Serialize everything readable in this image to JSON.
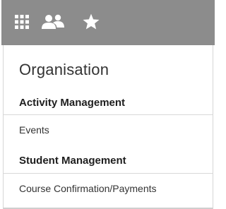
{
  "toolbar": {
    "icons": [
      "apps-grid-icon",
      "people-icon",
      "star-icon"
    ],
    "background": "#8c8c8c",
    "icon_color": "#ffffff"
  },
  "menu": {
    "title": "Organisation",
    "sections": [
      {
        "heading": "Activity Management",
        "items": [
          "Events"
        ]
      },
      {
        "heading": "Student Management",
        "items": [
          "Course Confirmation/Payments"
        ]
      }
    ]
  }
}
